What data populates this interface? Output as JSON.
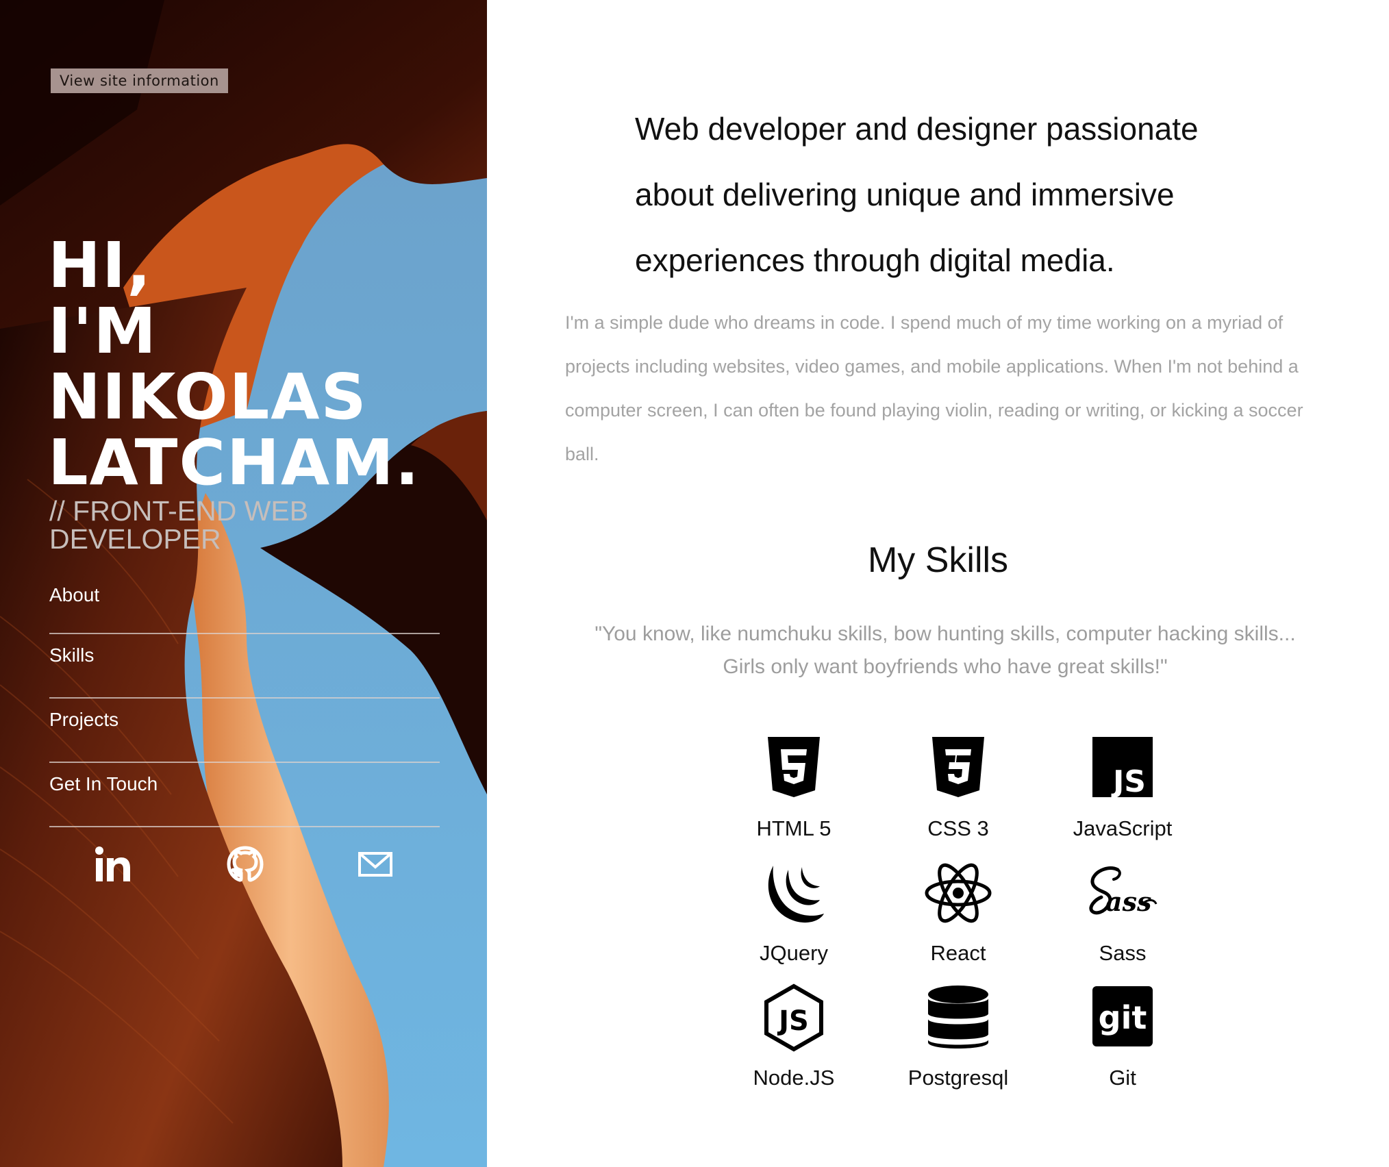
{
  "site_info_button": "View site information",
  "hero": {
    "name_lines": [
      "HI,",
      "I'M",
      "NIKOLAS",
      "LATCHAM."
    ],
    "role_lines": [
      "// FRONT-END WEB",
      "DEVELOPER"
    ]
  },
  "nav": {
    "items": [
      {
        "label": "About"
      },
      {
        "label": "Skills"
      },
      {
        "label": "Projects"
      },
      {
        "label": "Get In Touch"
      }
    ]
  },
  "social": [
    {
      "icon": "linkedin-icon"
    },
    {
      "icon": "github-icon"
    },
    {
      "icon": "mail-icon"
    }
  ],
  "intro": {
    "headline_lines": [
      "Web developer and designer passionate",
      "about delivering unique and immersive",
      "experiences through digital media."
    ],
    "bio": "I'm a simple dude who dreams in code. I spend much of my time working on a myriad of projects including websites, video games, and mobile applications. When I'm not behind a computer screen, I can often be found playing violin, reading or writing, or kicking a soccer ball."
  },
  "skills": {
    "title": "My Skills",
    "quote_lines": [
      "\"You know, like numchuku skills, bow hunting skills, computer hacking skills...",
      "Girls only want boyfriends who have great skills!\""
    ],
    "items": [
      {
        "label": "HTML 5",
        "icon": "html5-icon"
      },
      {
        "label": "CSS 3",
        "icon": "css3-icon"
      },
      {
        "label": "JavaScript",
        "icon": "javascript-icon"
      },
      {
        "label": "JQuery",
        "icon": "jquery-icon"
      },
      {
        "label": "React",
        "icon": "react-icon"
      },
      {
        "label": "Sass",
        "icon": "sass-icon"
      },
      {
        "label": "Node.JS",
        "icon": "nodejs-icon"
      },
      {
        "label": "Postgresql",
        "icon": "postgresql-icon"
      },
      {
        "label": "Git",
        "icon": "git-icon"
      }
    ]
  },
  "colors": {
    "text_dark": "#111111",
    "text_muted": "#a3a3a3",
    "sky": "#5ea9dc",
    "rock_dark": "#2a0d05",
    "rock_orange": "#c4581f",
    "rock_light": "#f3b07a"
  }
}
